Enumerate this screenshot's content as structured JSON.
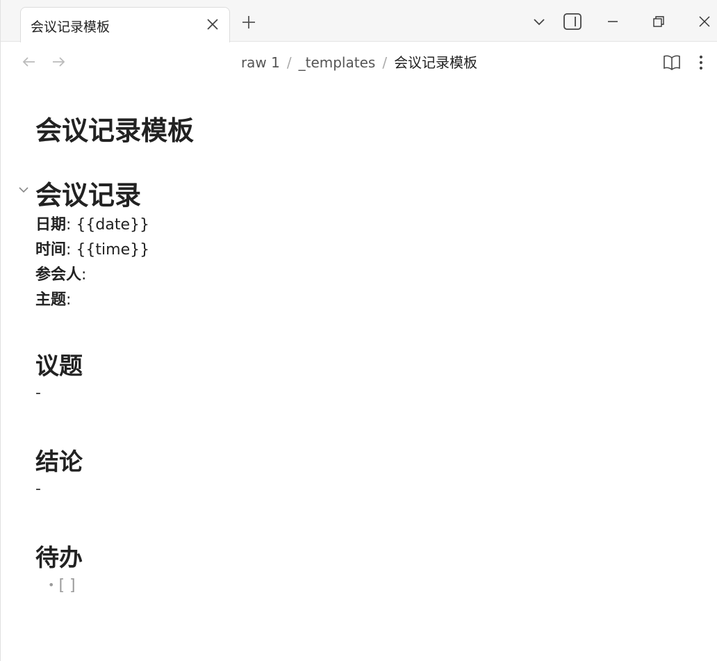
{
  "tab": {
    "title": "会议记录模板"
  },
  "breadcrumb": {
    "part1": "raw 1",
    "sep": "/",
    "part2": "_templates",
    "current": "会议记录模板"
  },
  "icons": {
    "tab_close": "close-icon",
    "new_tab": "plus-icon",
    "dropdown": "chevron-down-icon",
    "sidebar": "sidebar-toggle-icon",
    "minimize": "minimize-icon",
    "restore": "restore-icon",
    "close_window": "close-icon",
    "back": "arrow-left-icon",
    "forward": "arrow-right-icon",
    "reading_view": "book-open-icon",
    "more": "more-vertical-icon",
    "fold": "chevron-down-icon"
  },
  "doc": {
    "title": "会议记录模板",
    "heading_main": "会议记录",
    "fields": [
      {
        "label": "日期",
        "value": ": {{date}}"
      },
      {
        "label": "时间",
        "value": ": {{time}}"
      },
      {
        "label": "参会人",
        "value": ":"
      },
      {
        "label": "主题",
        "value": ":"
      }
    ],
    "sections": [
      {
        "heading": "议题",
        "body": "-"
      },
      {
        "heading": "结论",
        "body": "-"
      }
    ],
    "todo": {
      "heading": "待办",
      "bullet": "•",
      "item": "[ ]"
    }
  },
  "colors": {
    "text": "#222222",
    "muted": "#9a9a9a",
    "tab_bg": "#f6f6f6"
  }
}
